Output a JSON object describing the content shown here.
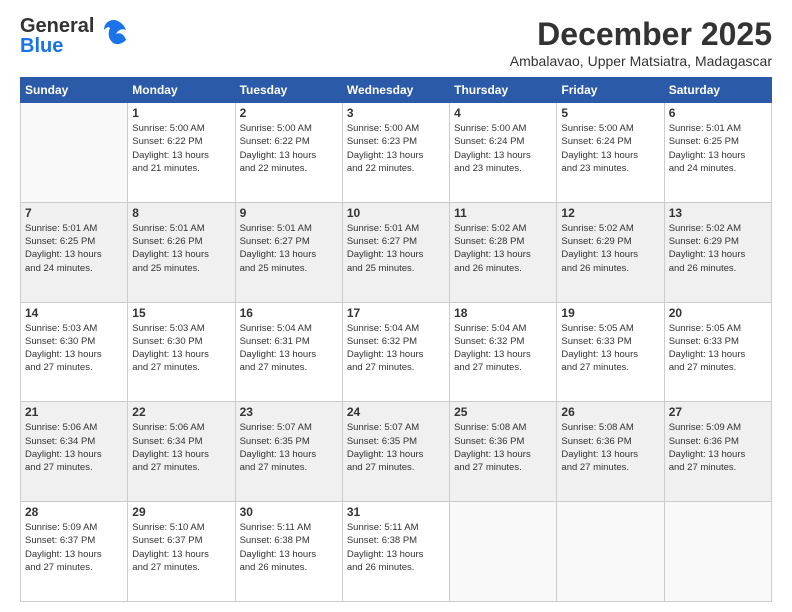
{
  "header": {
    "logo_line1": "General",
    "logo_line2": "Blue",
    "month": "December 2025",
    "location": "Ambalavao, Upper Matsiatra, Madagascar"
  },
  "weekdays": [
    "Sunday",
    "Monday",
    "Tuesday",
    "Wednesday",
    "Thursday",
    "Friday",
    "Saturday"
  ],
  "weeks": [
    [
      {
        "day": "",
        "empty": true
      },
      {
        "day": "1",
        "sunrise": "5:00 AM",
        "sunset": "6:22 PM",
        "daylight": "13 hours and 21 minutes."
      },
      {
        "day": "2",
        "sunrise": "5:00 AM",
        "sunset": "6:22 PM",
        "daylight": "13 hours and 22 minutes."
      },
      {
        "day": "3",
        "sunrise": "5:00 AM",
        "sunset": "6:23 PM",
        "daylight": "13 hours and 22 minutes."
      },
      {
        "day": "4",
        "sunrise": "5:00 AM",
        "sunset": "6:24 PM",
        "daylight": "13 hours and 23 minutes."
      },
      {
        "day": "5",
        "sunrise": "5:00 AM",
        "sunset": "6:24 PM",
        "daylight": "13 hours and 23 minutes."
      },
      {
        "day": "6",
        "sunrise": "5:01 AM",
        "sunset": "6:25 PM",
        "daylight": "13 hours and 24 minutes."
      }
    ],
    [
      {
        "day": "7",
        "sunrise": "5:01 AM",
        "sunset": "6:25 PM",
        "daylight": "13 hours and 24 minutes."
      },
      {
        "day": "8",
        "sunrise": "5:01 AM",
        "sunset": "6:26 PM",
        "daylight": "13 hours and 25 minutes."
      },
      {
        "day": "9",
        "sunrise": "5:01 AM",
        "sunset": "6:27 PM",
        "daylight": "13 hours and 25 minutes."
      },
      {
        "day": "10",
        "sunrise": "5:01 AM",
        "sunset": "6:27 PM",
        "daylight": "13 hours and 25 minutes."
      },
      {
        "day": "11",
        "sunrise": "5:02 AM",
        "sunset": "6:28 PM",
        "daylight": "13 hours and 26 minutes."
      },
      {
        "day": "12",
        "sunrise": "5:02 AM",
        "sunset": "6:29 PM",
        "daylight": "13 hours and 26 minutes."
      },
      {
        "day": "13",
        "sunrise": "5:02 AM",
        "sunset": "6:29 PM",
        "daylight": "13 hours and 26 minutes."
      }
    ],
    [
      {
        "day": "14",
        "sunrise": "5:03 AM",
        "sunset": "6:30 PM",
        "daylight": "13 hours and 27 minutes."
      },
      {
        "day": "15",
        "sunrise": "5:03 AM",
        "sunset": "6:30 PM",
        "daylight": "13 hours and 27 minutes."
      },
      {
        "day": "16",
        "sunrise": "5:04 AM",
        "sunset": "6:31 PM",
        "daylight": "13 hours and 27 minutes."
      },
      {
        "day": "17",
        "sunrise": "5:04 AM",
        "sunset": "6:32 PM",
        "daylight": "13 hours and 27 minutes."
      },
      {
        "day": "18",
        "sunrise": "5:04 AM",
        "sunset": "6:32 PM",
        "daylight": "13 hours and 27 minutes."
      },
      {
        "day": "19",
        "sunrise": "5:05 AM",
        "sunset": "6:33 PM",
        "daylight": "13 hours and 27 minutes."
      },
      {
        "day": "20",
        "sunrise": "5:05 AM",
        "sunset": "6:33 PM",
        "daylight": "13 hours and 27 minutes."
      }
    ],
    [
      {
        "day": "21",
        "sunrise": "5:06 AM",
        "sunset": "6:34 PM",
        "daylight": "13 hours and 27 minutes."
      },
      {
        "day": "22",
        "sunrise": "5:06 AM",
        "sunset": "6:34 PM",
        "daylight": "13 hours and 27 minutes."
      },
      {
        "day": "23",
        "sunrise": "5:07 AM",
        "sunset": "6:35 PM",
        "daylight": "13 hours and 27 minutes."
      },
      {
        "day": "24",
        "sunrise": "5:07 AM",
        "sunset": "6:35 PM",
        "daylight": "13 hours and 27 minutes."
      },
      {
        "day": "25",
        "sunrise": "5:08 AM",
        "sunset": "6:36 PM",
        "daylight": "13 hours and 27 minutes."
      },
      {
        "day": "26",
        "sunrise": "5:08 AM",
        "sunset": "6:36 PM",
        "daylight": "13 hours and 27 minutes."
      },
      {
        "day": "27",
        "sunrise": "5:09 AM",
        "sunset": "6:36 PM",
        "daylight": "13 hours and 27 minutes."
      }
    ],
    [
      {
        "day": "28",
        "sunrise": "5:09 AM",
        "sunset": "6:37 PM",
        "daylight": "13 hours and 27 minutes."
      },
      {
        "day": "29",
        "sunrise": "5:10 AM",
        "sunset": "6:37 PM",
        "daylight": "13 hours and 27 minutes."
      },
      {
        "day": "30",
        "sunrise": "5:11 AM",
        "sunset": "6:38 PM",
        "daylight": "13 hours and 26 minutes."
      },
      {
        "day": "31",
        "sunrise": "5:11 AM",
        "sunset": "6:38 PM",
        "daylight": "13 hours and 26 minutes."
      },
      {
        "day": "",
        "empty": true
      },
      {
        "day": "",
        "empty": true
      },
      {
        "day": "",
        "empty": true
      }
    ]
  ],
  "labels": {
    "sunrise": "Sunrise:",
    "sunset": "Sunset:",
    "daylight": "Daylight:"
  }
}
